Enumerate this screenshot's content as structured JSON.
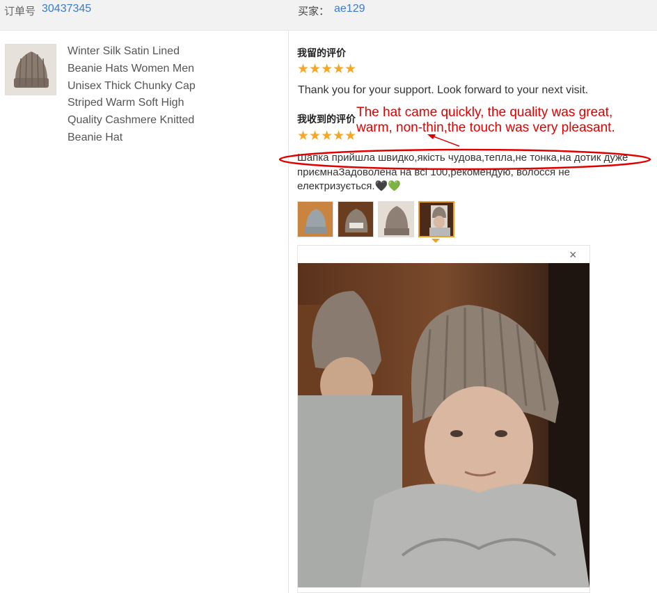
{
  "order": {
    "label": "订单号",
    "value": "30437345"
  },
  "buyer": {
    "label": "买家：",
    "value": "ae129"
  },
  "product": {
    "title": "Winter Silk Satin Lined Beanie Hats Women Men Unisex Thick Chunky Cap Striped Warm Soft High Quality Cashmere Knitted Beanie Hat"
  },
  "my_review": {
    "heading": "我留的评价",
    "stars": "★★★★★",
    "rating": 5,
    "text": "Thank you for your support. Look forward to your next visit."
  },
  "received_review": {
    "heading": "我收到的评价",
    "stars": "★★★★★",
    "rating": 5,
    "text": "Шапка прийшла швидко,якість чудова,тепла,не тонка,на дотик дуже приємнаЗадоволена на всі 100,рекомендую, волосся не електризується.🖤💚"
  },
  "annotation": {
    "line1": "The hat came quickly, the quality was great,",
    "line2": "warm, non-thin,the touch was very pleasant."
  },
  "photos": {
    "count": 4,
    "selected_index": 3,
    "close_glyph": "×"
  },
  "colors": {
    "accent_link": "#3a7bc8",
    "star": "#f5a623",
    "annotation": "#e00000",
    "selected_border": "#f0a020"
  }
}
